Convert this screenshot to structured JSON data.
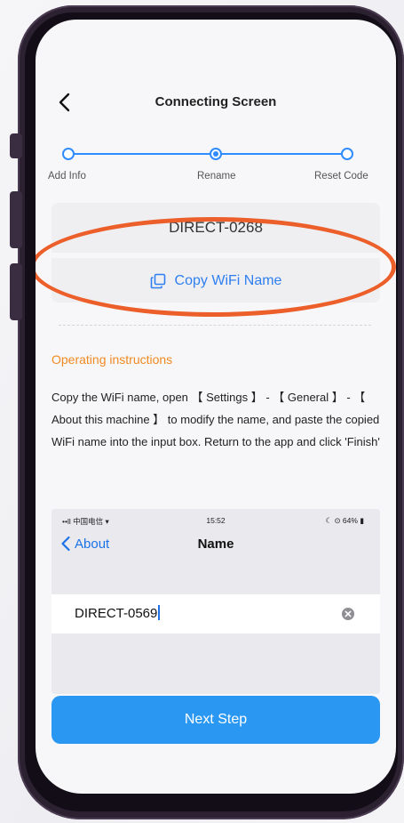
{
  "nav": {
    "title": "Connecting Screen",
    "back_icon": "chevron-left-icon"
  },
  "stepper": {
    "steps": [
      {
        "label": "Add Info",
        "state": "done"
      },
      {
        "label": "Rename",
        "state": "current"
      },
      {
        "label": "Reset Code",
        "state": "pending"
      }
    ]
  },
  "wifi": {
    "name": "DIRECT-0268",
    "copy_label": "Copy WiFi Name",
    "copy_icon": "copy-icon"
  },
  "instructions": {
    "title": "Operating instructions",
    "body": "Copy the WiFi name, open 【 Settings 】 - 【 General 】 - 【 About this machine 】 to modify the name, and paste the copied WiFi name into the input box. Return to the app and click 'Finish'"
  },
  "example_screenshot": {
    "carrier": "••ll 中国电信 ▾",
    "time": "15:52",
    "battery": "☾ ⊙ 64% ▮",
    "back_label": "About",
    "title": "Name",
    "field_value": "DIRECT-0569"
  },
  "next_button": {
    "label": "Next Step"
  },
  "colors": {
    "accent": "#2f8cff",
    "orange": "#f08a22",
    "highlight": "#ec5f2a",
    "button": "#2a98f3"
  }
}
